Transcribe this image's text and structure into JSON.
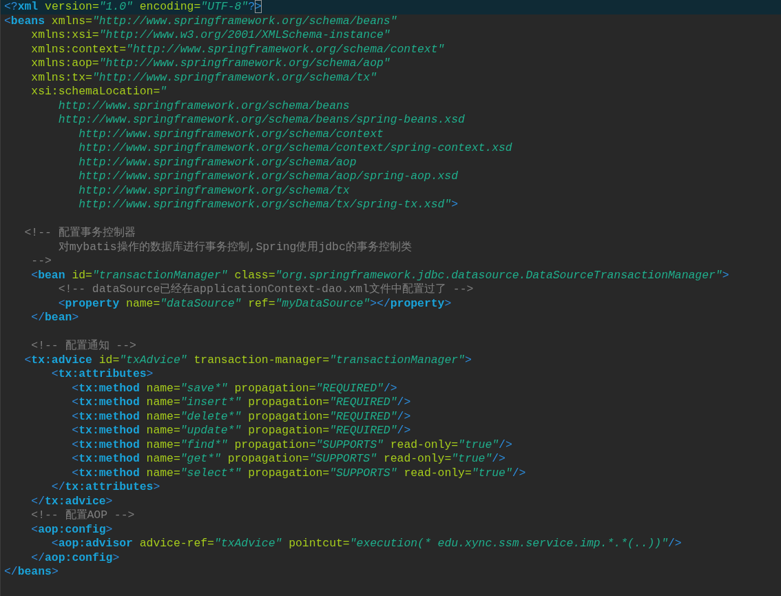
{
  "editor": {
    "lines": [
      {
        "current": true,
        "tokens": [
          {
            "kind": "bracket",
            "text": "<?"
          },
          {
            "kind": "tag",
            "text": "xml"
          },
          {
            "kind": "attr",
            "text": " version="
          },
          {
            "kind": "value",
            "text": "\"1.0\""
          },
          {
            "kind": "attr",
            "text": " encoding="
          },
          {
            "kind": "value",
            "text": "\"UTF-8\""
          },
          {
            "kind": "bracket",
            "text": "?"
          },
          {
            "kind": "match",
            "text": ">"
          }
        ]
      },
      {
        "current": false,
        "tokens": [
          {
            "kind": "bracket",
            "text": "<"
          },
          {
            "kind": "tag",
            "text": "beans"
          },
          {
            "kind": "attr",
            "text": " xmlns="
          },
          {
            "kind": "value",
            "text": "\"http://www.springframework.org/schema/beans\""
          }
        ]
      },
      {
        "current": false,
        "tokens": [
          {
            "kind": "attr",
            "text": "    xmlns:xsi="
          },
          {
            "kind": "value",
            "text": "\"http://www.w3.org/2001/XMLSchema-instance\""
          }
        ]
      },
      {
        "current": false,
        "tokens": [
          {
            "kind": "attr",
            "text": "    xmlns:context="
          },
          {
            "kind": "value",
            "text": "\"http://www.springframework.org/schema/context\""
          }
        ]
      },
      {
        "current": false,
        "tokens": [
          {
            "kind": "attr",
            "text": "    xmlns:aop="
          },
          {
            "kind": "value",
            "text": "\"http://www.springframework.org/schema/aop\""
          }
        ]
      },
      {
        "current": false,
        "tokens": [
          {
            "kind": "attr",
            "text": "    xmlns:tx="
          },
          {
            "kind": "value",
            "text": "\"http://www.springframework.org/schema/tx\""
          }
        ]
      },
      {
        "current": false,
        "tokens": [
          {
            "kind": "attr",
            "text": "    xsi:schemaLocation="
          },
          {
            "kind": "value",
            "text": "\""
          }
        ]
      },
      {
        "current": false,
        "tokens": [
          {
            "kind": "value",
            "text": "        http://www.springframework.org/schema/beans"
          }
        ]
      },
      {
        "current": false,
        "tokens": [
          {
            "kind": "value",
            "text": "        http://www.springframework.org/schema/beans/spring-beans.xsd"
          }
        ]
      },
      {
        "current": false,
        "tokens": [
          {
            "kind": "value",
            "text": "           http://www.springframework.org/schema/context"
          }
        ]
      },
      {
        "current": false,
        "tokens": [
          {
            "kind": "value",
            "text": "           http://www.springframework.org/schema/context/spring-context.xsd"
          }
        ]
      },
      {
        "current": false,
        "tokens": [
          {
            "kind": "value",
            "text": "           http://www.springframework.org/schema/aop"
          }
        ]
      },
      {
        "current": false,
        "tokens": [
          {
            "kind": "value",
            "text": "           http://www.springframework.org/schema/aop/spring-aop.xsd"
          }
        ]
      },
      {
        "current": false,
        "tokens": [
          {
            "kind": "value",
            "text": "           http://www.springframework.org/schema/tx"
          }
        ]
      },
      {
        "current": false,
        "tokens": [
          {
            "kind": "value",
            "text": "           http://www.springframework.org/schema/tx/spring-tx.xsd\""
          },
          {
            "kind": "bracket",
            "text": ">"
          }
        ]
      },
      {
        "current": false
      },
      {
        "current": false,
        "tokens": [
          {
            "kind": "comment",
            "text": "   <!-- 配置事务控制器"
          }
        ]
      },
      {
        "current": false,
        "tokens": [
          {
            "kind": "comment",
            "text": "        对mybatis操作的数据库进行事务控制,Spring使用jdbc的事务控制类"
          }
        ]
      },
      {
        "current": false,
        "tokens": [
          {
            "kind": "comment",
            "text": "    -->"
          }
        ]
      },
      {
        "current": false,
        "tokens": [
          {
            "kind": "bracket",
            "text": "    <"
          },
          {
            "kind": "tag",
            "text": "bean"
          },
          {
            "kind": "attr",
            "text": " id="
          },
          {
            "kind": "value",
            "text": "\"transactionManager\""
          },
          {
            "kind": "attr",
            "text": " class="
          },
          {
            "kind": "value",
            "text": "\"org.springframework.jdbc.datasource.DataSourceTransactionManager\""
          },
          {
            "kind": "bracket",
            "text": ">"
          }
        ]
      },
      {
        "current": false,
        "tokens": [
          {
            "kind": "comment",
            "text": "        <!-- dataSource已经在applicationContext-dao.xml文件中配置过了 -->"
          }
        ]
      },
      {
        "current": false,
        "tokens": [
          {
            "kind": "bracket",
            "text": "        <"
          },
          {
            "kind": "tag",
            "text": "property"
          },
          {
            "kind": "attr",
            "text": " name="
          },
          {
            "kind": "value",
            "text": "\"dataSource\""
          },
          {
            "kind": "attr",
            "text": " ref="
          },
          {
            "kind": "value",
            "text": "\"myDataSource\""
          },
          {
            "kind": "bracket",
            "text": "></"
          },
          {
            "kind": "tag",
            "text": "property"
          },
          {
            "kind": "bracket",
            "text": ">"
          }
        ]
      },
      {
        "current": false,
        "tokens": [
          {
            "kind": "bracket",
            "text": "    </"
          },
          {
            "kind": "tag",
            "text": "bean"
          },
          {
            "kind": "bracket",
            "text": ">"
          }
        ]
      },
      {
        "current": false
      },
      {
        "current": false,
        "tokens": [
          {
            "kind": "comment",
            "text": "    <!-- 配置通知 -->"
          }
        ]
      },
      {
        "current": false,
        "tokens": [
          {
            "kind": "bracket",
            "text": "   <"
          },
          {
            "kind": "tag",
            "text": "tx:advice"
          },
          {
            "kind": "attr",
            "text": " id="
          },
          {
            "kind": "value",
            "text": "\"txAdvice\""
          },
          {
            "kind": "attr",
            "text": " transaction-manager="
          },
          {
            "kind": "value",
            "text": "\"transactionManager\""
          },
          {
            "kind": "bracket",
            "text": ">"
          }
        ]
      },
      {
        "current": false,
        "tokens": [
          {
            "kind": "bracket",
            "text": "       <"
          },
          {
            "kind": "tag",
            "text": "tx:attributes"
          },
          {
            "kind": "bracket",
            "text": ">"
          }
        ]
      },
      {
        "current": false,
        "tokens": [
          {
            "kind": "bracket",
            "text": "          <"
          },
          {
            "kind": "tag",
            "text": "tx:method"
          },
          {
            "kind": "attr",
            "text": " name="
          },
          {
            "kind": "value",
            "text": "\"save*\""
          },
          {
            "kind": "attr",
            "text": " propagation="
          },
          {
            "kind": "value",
            "text": "\"REQUIRED\""
          },
          {
            "kind": "bracket",
            "text": "/>"
          }
        ]
      },
      {
        "current": false,
        "tokens": [
          {
            "kind": "bracket",
            "text": "          <"
          },
          {
            "kind": "tag",
            "text": "tx:method"
          },
          {
            "kind": "attr",
            "text": " name="
          },
          {
            "kind": "value",
            "text": "\"insert*\""
          },
          {
            "kind": "attr",
            "text": " propagation="
          },
          {
            "kind": "value",
            "text": "\"REQUIRED\""
          },
          {
            "kind": "bracket",
            "text": "/>"
          }
        ]
      },
      {
        "current": false,
        "tokens": [
          {
            "kind": "bracket",
            "text": "          <"
          },
          {
            "kind": "tag",
            "text": "tx:method"
          },
          {
            "kind": "attr",
            "text": " name="
          },
          {
            "kind": "value",
            "text": "\"delete*\""
          },
          {
            "kind": "attr",
            "text": " propagation="
          },
          {
            "kind": "value",
            "text": "\"REQUIRED\""
          },
          {
            "kind": "bracket",
            "text": "/>"
          }
        ]
      },
      {
        "current": false,
        "tokens": [
          {
            "kind": "bracket",
            "text": "          <"
          },
          {
            "kind": "tag",
            "text": "tx:method"
          },
          {
            "kind": "attr",
            "text": " name="
          },
          {
            "kind": "value",
            "text": "\"update*\""
          },
          {
            "kind": "attr",
            "text": " propagation="
          },
          {
            "kind": "value",
            "text": "\"REQUIRED\""
          },
          {
            "kind": "bracket",
            "text": "/>"
          }
        ]
      },
      {
        "current": false,
        "tokens": [
          {
            "kind": "bracket",
            "text": "          <"
          },
          {
            "kind": "tag",
            "text": "tx:method"
          },
          {
            "kind": "attr",
            "text": " name="
          },
          {
            "kind": "value",
            "text": "\"find*\""
          },
          {
            "kind": "attr",
            "text": " propagation="
          },
          {
            "kind": "value",
            "text": "\"SUPPORTS\""
          },
          {
            "kind": "attr",
            "text": " read-only="
          },
          {
            "kind": "value",
            "text": "\"true\""
          },
          {
            "kind": "bracket",
            "text": "/>"
          }
        ]
      },
      {
        "current": false,
        "tokens": [
          {
            "kind": "bracket",
            "text": "          <"
          },
          {
            "kind": "tag",
            "text": "tx:method"
          },
          {
            "kind": "attr",
            "text": " name="
          },
          {
            "kind": "value",
            "text": "\"get*\""
          },
          {
            "kind": "attr",
            "text": " propagation="
          },
          {
            "kind": "value",
            "text": "\"SUPPORTS\""
          },
          {
            "kind": "attr",
            "text": " read-only="
          },
          {
            "kind": "value",
            "text": "\"true\""
          },
          {
            "kind": "bracket",
            "text": "/>"
          }
        ]
      },
      {
        "current": false,
        "tokens": [
          {
            "kind": "bracket",
            "text": "          <"
          },
          {
            "kind": "tag",
            "text": "tx:method"
          },
          {
            "kind": "attr",
            "text": " name="
          },
          {
            "kind": "value",
            "text": "\"select*\""
          },
          {
            "kind": "attr",
            "text": " propagation="
          },
          {
            "kind": "value",
            "text": "\"SUPPORTS\""
          },
          {
            "kind": "attr",
            "text": " read-only="
          },
          {
            "kind": "value",
            "text": "\"true\""
          },
          {
            "kind": "bracket",
            "text": "/>"
          }
        ]
      },
      {
        "current": false,
        "tokens": [
          {
            "kind": "bracket",
            "text": "       </"
          },
          {
            "kind": "tag",
            "text": "tx:attributes"
          },
          {
            "kind": "bracket",
            "text": ">"
          }
        ]
      },
      {
        "current": false,
        "tokens": [
          {
            "kind": "bracket",
            "text": "    </"
          },
          {
            "kind": "tag",
            "text": "tx:advice"
          },
          {
            "kind": "bracket",
            "text": ">"
          }
        ]
      },
      {
        "current": false,
        "tokens": [
          {
            "kind": "comment",
            "text": "    <!-- 配置AOP -->"
          }
        ]
      },
      {
        "current": false,
        "tokens": [
          {
            "kind": "bracket",
            "text": "    <"
          },
          {
            "kind": "tag",
            "text": "aop:config"
          },
          {
            "kind": "bracket",
            "text": ">"
          }
        ]
      },
      {
        "current": false,
        "tokens": [
          {
            "kind": "bracket",
            "text": "       <"
          },
          {
            "kind": "tag",
            "text": "aop:advisor"
          },
          {
            "kind": "attr",
            "text": " advice-ref="
          },
          {
            "kind": "value",
            "text": "\"txAdvice\""
          },
          {
            "kind": "attr",
            "text": " pointcut="
          },
          {
            "kind": "value",
            "text": "\"execution(* edu.xync.ssm.service.imp.*.*(..))\""
          },
          {
            "kind": "bracket",
            "text": "/>"
          }
        ]
      },
      {
        "current": false,
        "tokens": [
          {
            "kind": "bracket",
            "text": "    </"
          },
          {
            "kind": "tag",
            "text": "aop:config"
          },
          {
            "kind": "bracket",
            "text": ">"
          }
        ]
      },
      {
        "current": false,
        "tokens": [
          {
            "kind": "bracket",
            "text": "</"
          },
          {
            "kind": "tag",
            "text": "beans"
          },
          {
            "kind": "bracket",
            "text": ">"
          }
        ]
      }
    ]
  }
}
